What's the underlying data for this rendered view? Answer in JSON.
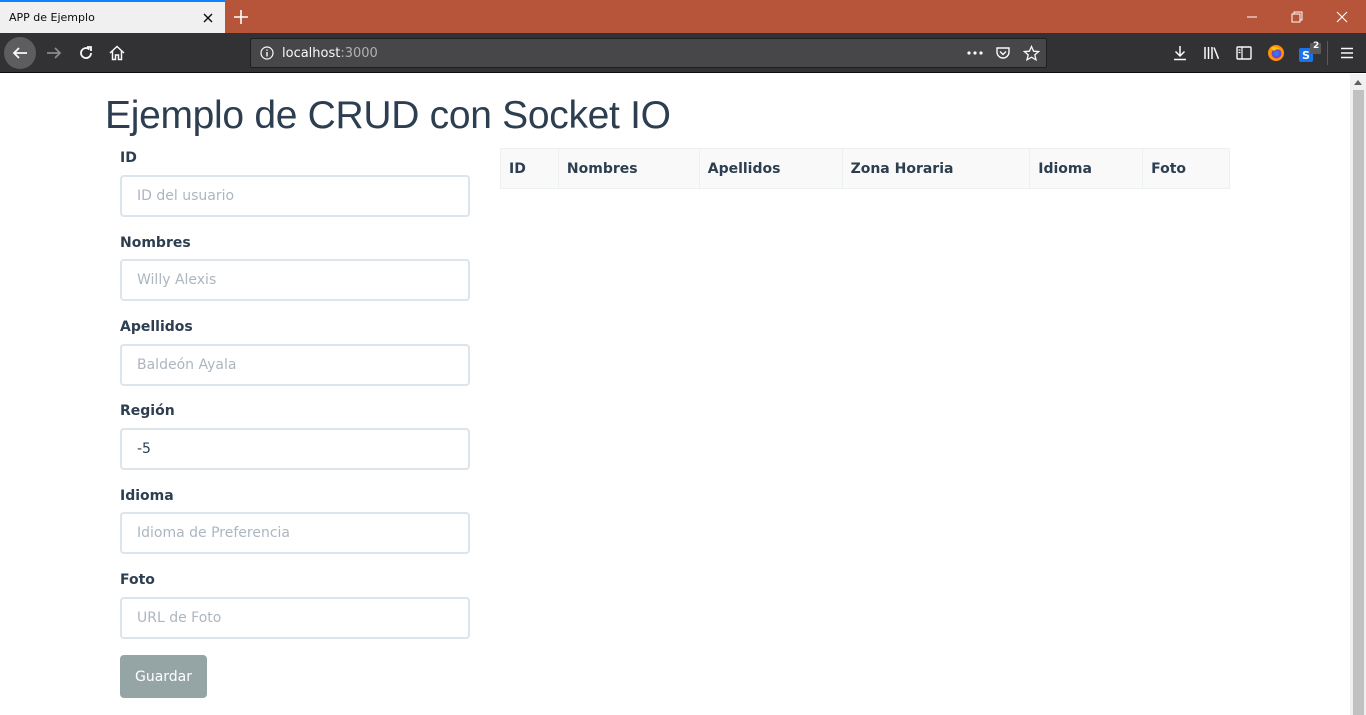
{
  "browser": {
    "tab_title": "APP de Ejemplo",
    "url_host": "localhost",
    "url_port": ":3000",
    "sync_badge": "2",
    "colors": {
      "titlebar": "#b6553a",
      "toolbar": "#323234",
      "tab_accent": "#0a84ff"
    }
  },
  "page": {
    "title": "Ejemplo de CRUD con Socket IO"
  },
  "form": {
    "fields": [
      {
        "label": "ID",
        "value": "",
        "placeholder": "ID del usuario"
      },
      {
        "label": "Nombres",
        "value": "",
        "placeholder": "Willy Alexis"
      },
      {
        "label": "Apellidos",
        "value": "",
        "placeholder": "Baldeón Ayala"
      },
      {
        "label": "Región",
        "value": "-5",
        "placeholder": ""
      },
      {
        "label": "Idioma",
        "value": "",
        "placeholder": "Idioma de Preferencia"
      },
      {
        "label": "Foto",
        "value": "",
        "placeholder": "URL de Foto"
      }
    ],
    "submit_label": "Guardar"
  },
  "table": {
    "columns": [
      "ID",
      "Nombres",
      "Apellidos",
      "Zona Horaria",
      "Idioma",
      "Foto"
    ],
    "rows": []
  }
}
